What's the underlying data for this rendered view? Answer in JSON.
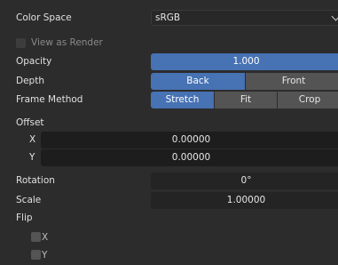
{
  "color_space": {
    "label": "Color Space",
    "value": "sRGB"
  },
  "view_as_render": {
    "label": "View as Render",
    "checked": false
  },
  "opacity": {
    "label": "Opacity",
    "value": "1.000",
    "fill": 1.0
  },
  "depth": {
    "label": "Depth",
    "options": [
      "Back",
      "Front"
    ],
    "selected": "Back"
  },
  "frame_method": {
    "label": "Frame Method",
    "options": [
      "Stretch",
      "Fit",
      "Crop"
    ],
    "selected": "Stretch"
  },
  "offset": {
    "label": "Offset",
    "x": {
      "label": "X",
      "value": "0.00000"
    },
    "y": {
      "label": "Y",
      "value": "0.00000"
    }
  },
  "rotation": {
    "label": "Rotation",
    "value": "0°"
  },
  "scale": {
    "label": "Scale",
    "value": "1.00000"
  },
  "flip": {
    "label": "Flip",
    "x": {
      "label": "X",
      "checked": false
    },
    "y": {
      "label": "Y",
      "checked": false
    }
  },
  "colors": {
    "accent": "#4772b3",
    "panel": "#2c2c2c",
    "field": "#545454",
    "field_dark": "#1d1d1d"
  }
}
